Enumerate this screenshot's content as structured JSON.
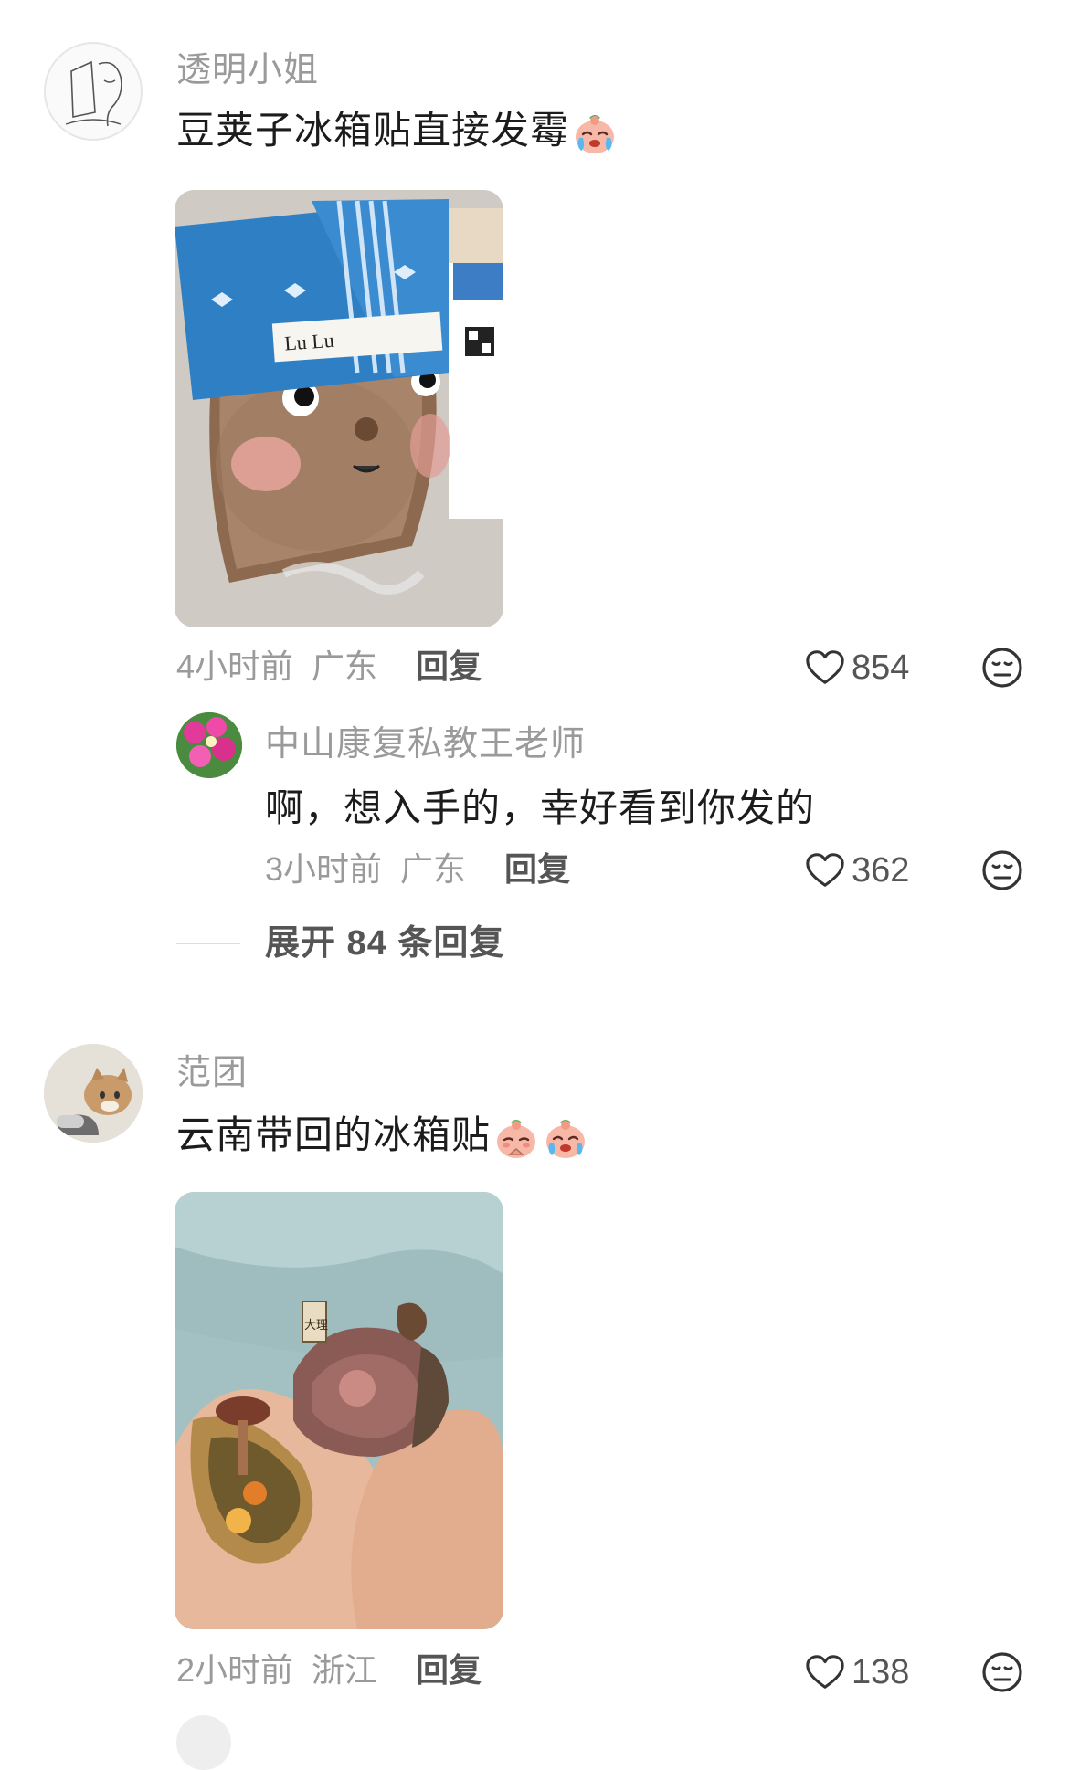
{
  "comments": [
    {
      "username": "透明小姐",
      "text": "豆荚子冰箱贴直接发霉",
      "emojis": [
        "crying-face-emoji"
      ],
      "photo": {
        "caption": "Lu Lu"
      },
      "time": "4小时前",
      "location": "广东",
      "reply_label": "回复",
      "likes": "854",
      "replies": [
        {
          "username": "中山康复私教王老师",
          "text": "啊，想入手的，幸好看到你发的",
          "time": "3小时前",
          "location": "广东",
          "reply_label": "回复",
          "likes": "362"
        }
      ],
      "expand_label": "展开 84 条回复"
    },
    {
      "username": "范团",
      "text": "云南带回的冰箱贴",
      "emojis": [
        "pleading-face-emoji",
        "crying-face-emoji"
      ],
      "photo": {
        "caption": "大理"
      },
      "time": "2小时前",
      "location": "浙江",
      "reply_label": "回复",
      "likes": "138"
    }
  ],
  "colors": {
    "meta_gray": "#9a9a9a",
    "text_dark": "#1c1c1c",
    "hat_blue": "#2f7fc4"
  }
}
